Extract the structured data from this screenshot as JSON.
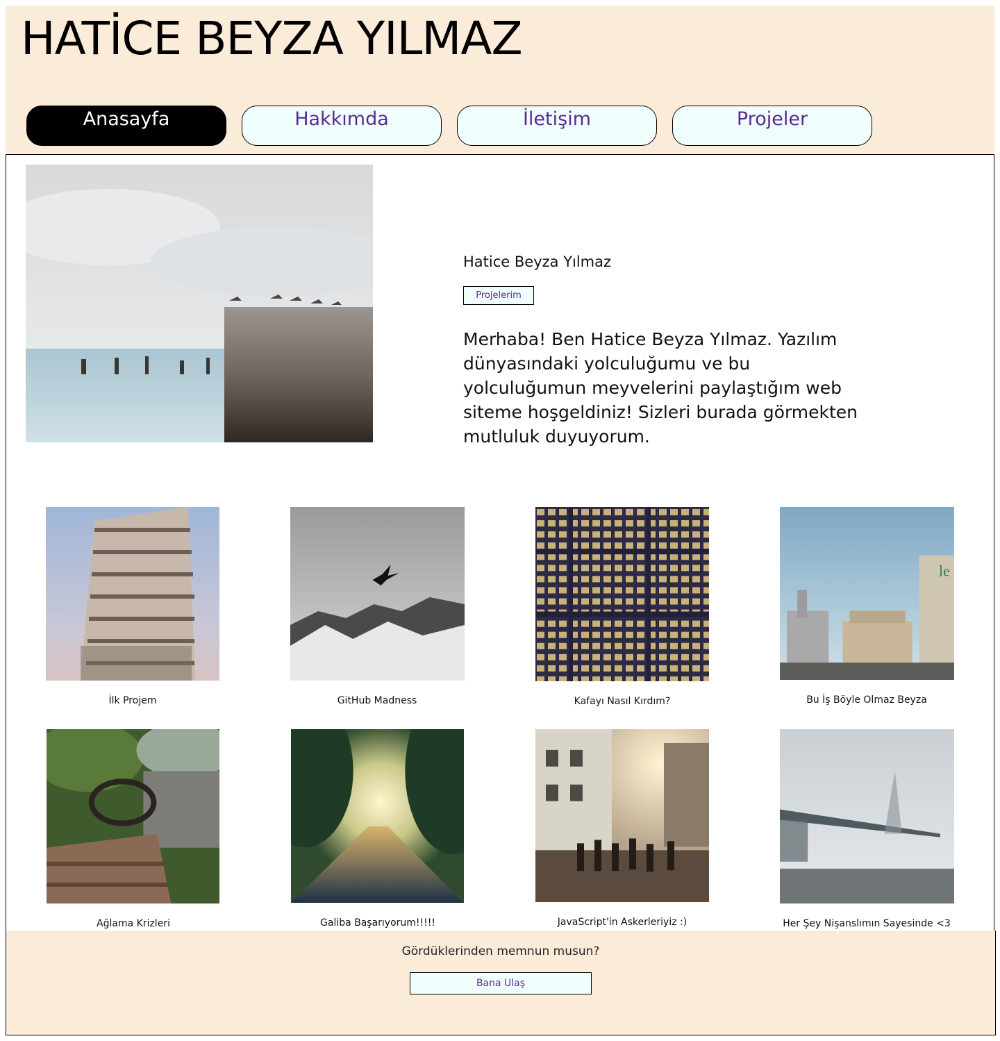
{
  "header": {
    "title": "HATİCE BEYZA YILMAZ",
    "nav": [
      {
        "label": "Anasayfa",
        "active": true
      },
      {
        "label": "Hakkımda",
        "active": false
      },
      {
        "label": "İletişim",
        "active": false
      },
      {
        "label": "Projeler",
        "active": false
      }
    ]
  },
  "hero": {
    "name": "Hatice Beyza Yılmaz",
    "button_label": "Projelerim",
    "text": "Merhaba! Ben Hatice Beyza Yılmaz. Yazılım dünyasındaki yolculuğumu ve bu yolculuğumun meyvelerini paylaştığım web siteme hoşgeldiniz! Sizleri burada görmekten mutluluk duyuyorum."
  },
  "projects": [
    {
      "caption": "İlk Projem",
      "image": "leaning-tower-photo"
    },
    {
      "caption": "GitHub Madness",
      "image": "bird-over-mountains-photo"
    },
    {
      "caption": "Kafayı Nasıl Kırdım?",
      "image": "office-building-night-photo"
    },
    {
      "caption": "Bu İş Böyle Olmaz Beyza",
      "image": "industrial-tanks-photo"
    },
    {
      "caption": "Ağlama Krizleri",
      "image": "abandoned-car-interior-photo"
    },
    {
      "caption": "Galiba Başarıyorum!!!!!",
      "image": "sunlit-forest-road-photo"
    },
    {
      "caption": "JavaScript'in Askerleriyiz :)",
      "image": "busy-city-street-photo"
    },
    {
      "caption": "Her Şey Nişanslımın Sayesinde <3",
      "image": "foggy-bridge-photo"
    }
  ],
  "footer": {
    "question": "Gördüklerinden memnun musun?",
    "button_label": "Bana Ulaş"
  }
}
